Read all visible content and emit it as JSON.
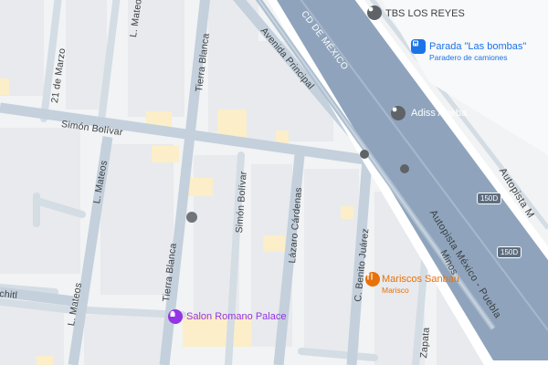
{
  "colors": {
    "land": "#f1f3f4",
    "block": "#e8eaed",
    "street": "#d4dce4",
    "arterial": "#c4d0dc",
    "highway": "#8fa4bc",
    "highway_edge": "#ffffff",
    "highlight_building": "#fbeec8",
    "food": "#e8710a",
    "venue": "#9334e6",
    "transit": "#1a73e8",
    "gray_pin": "#5f6368"
  },
  "streets": {
    "tierra_blanca_top": "Tierra Blanca",
    "tierra_blanca_bottom": "Tierra Blanca",
    "mateos_top": "L. Mateos",
    "mateos_mid": "L. Mateos",
    "mateos_bottom": "L. Mateos",
    "marzo": "21 de Marzo",
    "simon_bolivar_h": "Simón Bolívar",
    "simon_bolivar_v": "Simón Bolívar",
    "lazaro": "Lázaro Cárdenas",
    "benito": "C. Benito Juárez",
    "minos": "Minos",
    "zapata": "Zapata",
    "avenida": "Avenida Principal",
    "achitl": "chitl"
  },
  "highways": {
    "cd_mexico": "CD DE MÉXICO",
    "autopista_main": "Autopista México - Puebla",
    "autopista_right": "Autopista M",
    "shield_1": "150D",
    "shield_2": "150D"
  },
  "pois": {
    "tbs": {
      "icon": "gray-pin-icon",
      "name": "TBS LOS REYES"
    },
    "parada": {
      "icon": "bus-stop-icon",
      "name": "Parada \"Las bombas\"",
      "subtitle": "Paradero de camiones"
    },
    "adiss": {
      "icon": "gray-pin-icon",
      "name": "Adiss Abeba"
    },
    "mariscos": {
      "icon": "restaurant-icon",
      "name": "Mariscos Sanbau",
      "subtitle": "Marisco"
    },
    "salon": {
      "icon": "venue-icon",
      "name": "Salon Romano Palace"
    }
  }
}
